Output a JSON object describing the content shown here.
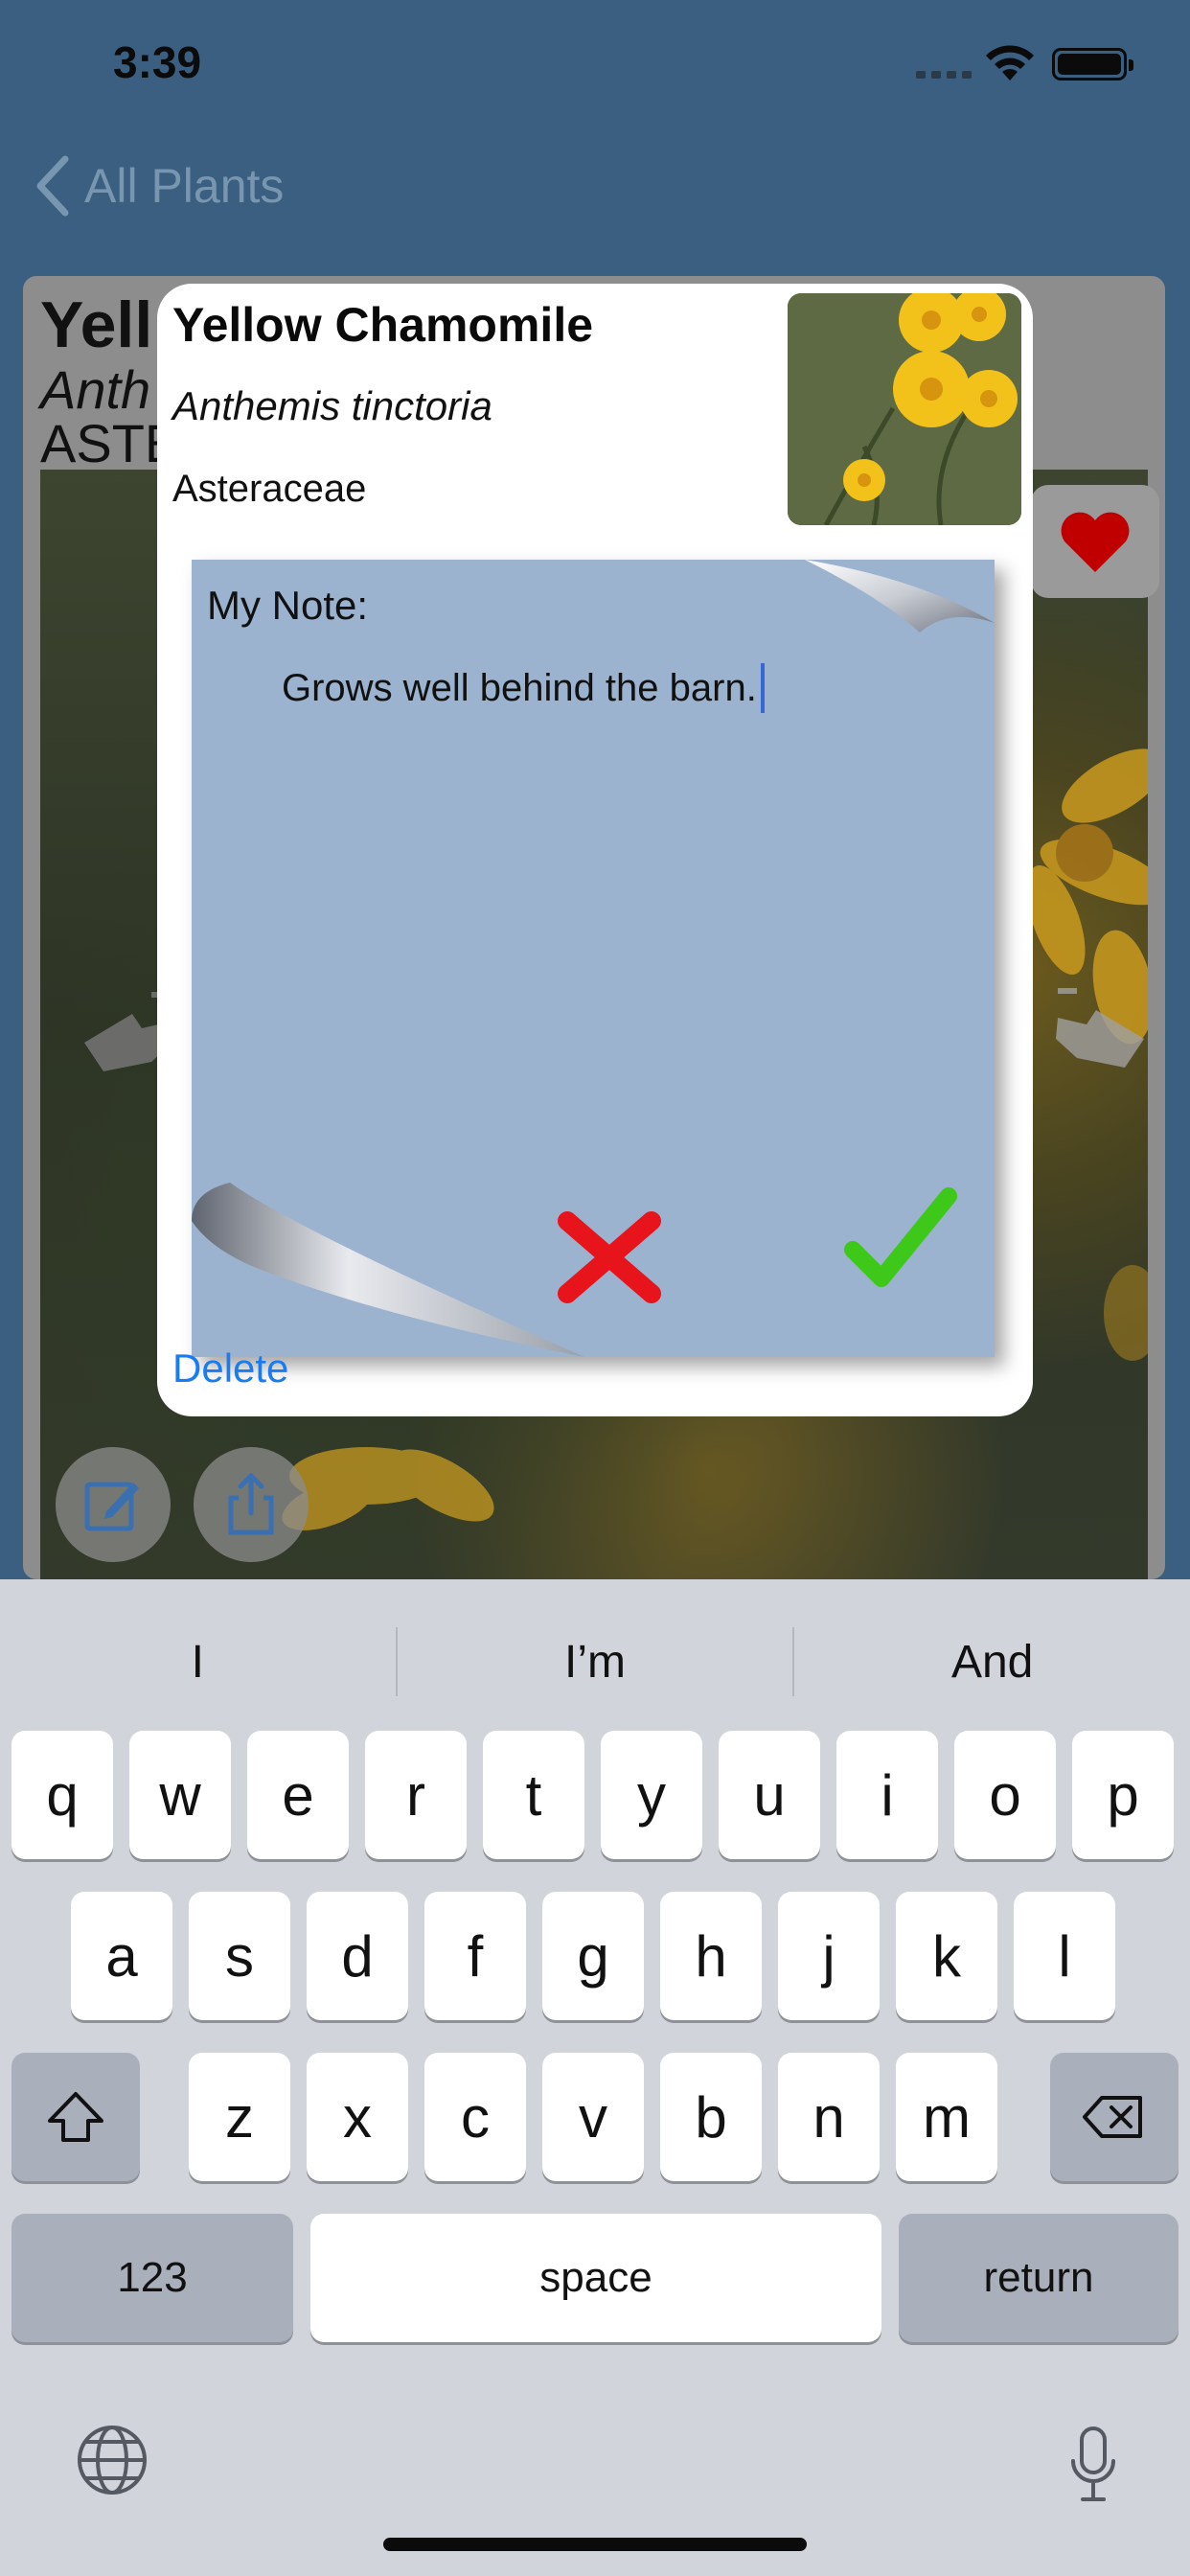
{
  "status_bar": {
    "time": "3:39"
  },
  "nav": {
    "back_label": "All Plants"
  },
  "background_card": {
    "title": "Yell",
    "scientific": "Anth",
    "family": "ASTE"
  },
  "dialog": {
    "common_name": "Yellow Chamomile",
    "scientific_name": "Anthemis tinctoria",
    "family": "Asteraceae",
    "note_label": "My Note:",
    "note_text": "Grows well behind the barn.",
    "delete_label": "Delete"
  },
  "keyboard": {
    "suggestions": [
      "I",
      "I’m",
      "And"
    ],
    "row1": [
      "q",
      "w",
      "e",
      "r",
      "t",
      "y",
      "u",
      "i",
      "o",
      "p"
    ],
    "row2": [
      "a",
      "s",
      "d",
      "f",
      "g",
      "h",
      "j",
      "k",
      "l"
    ],
    "row3": [
      "z",
      "x",
      "c",
      "v",
      "b",
      "n",
      "m"
    ],
    "numbers_label": "123",
    "space_label": "space",
    "return_label": "return"
  },
  "colors": {
    "background": "#3a5f80",
    "note_paper": "#9bb3cf",
    "delete_link": "#1a7cf0",
    "cancel": "#e8141c",
    "confirm": "#3ec81a",
    "heart": "#c00000"
  }
}
